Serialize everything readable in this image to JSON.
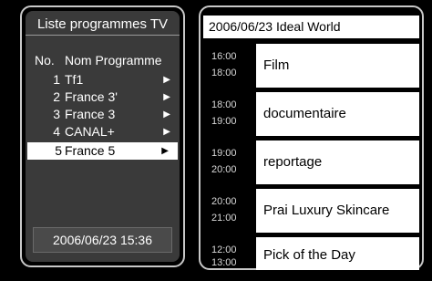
{
  "left": {
    "title": "Liste programmes TV",
    "col_no": "No.",
    "col_name": "Nom Programme",
    "channels": [
      {
        "num": "1",
        "name": "Tf1",
        "arrow": "▶"
      },
      {
        "num": "2",
        "name": "France 3'",
        "arrow": "▶"
      },
      {
        "num": "3",
        "name": "France 3",
        "arrow": "▶"
      },
      {
        "num": "4",
        "name": "CANAL+",
        "arrow": "▶"
      },
      {
        "num": "5",
        "name": "France 5",
        "arrow": "▶"
      }
    ],
    "datetime": "2006/06/23 15:36"
  },
  "right": {
    "header": "2006/06/23  Ideal World",
    "events": [
      {
        "start": "16:00",
        "end": "18:00",
        "title": "Film"
      },
      {
        "start": "18:00",
        "end": "19:00",
        "title": "documentaire"
      },
      {
        "start": "19:00",
        "end": "20:00",
        "title": "reportage"
      },
      {
        "start": "20:00",
        "end": "21:00",
        "title": "Prai Luxury Skincare"
      },
      {
        "start": "12:00",
        "end": "13:00",
        "title": "Pick of the Day"
      }
    ]
  }
}
